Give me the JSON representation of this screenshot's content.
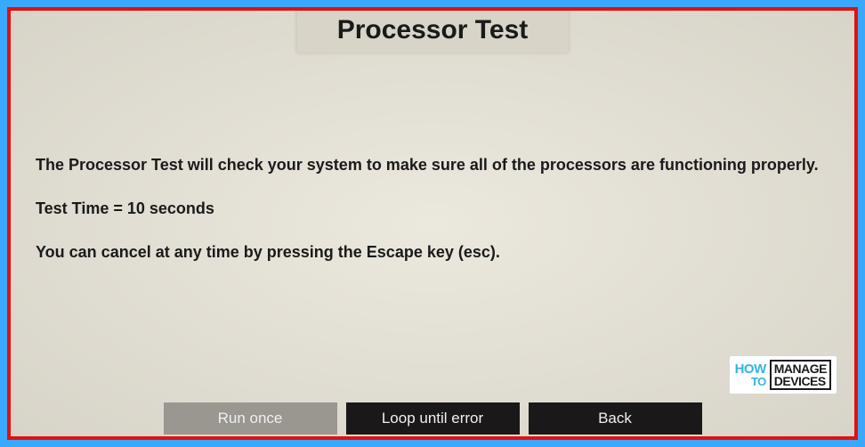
{
  "title": "Processor Test",
  "content": {
    "description": "The Processor Test will check your system to make sure all of the processors are functioning properly.",
    "test_time": "Test Time = 10 seconds",
    "cancel_info": "You can cancel at any time by pressing the Escape key (esc)."
  },
  "buttons": {
    "run_once": "Run once",
    "loop_until_error": "Loop until error",
    "back": "Back"
  },
  "watermark": {
    "how": "HOW",
    "to": "TO",
    "manage": "MANAGE",
    "devices": "DEVICES"
  }
}
